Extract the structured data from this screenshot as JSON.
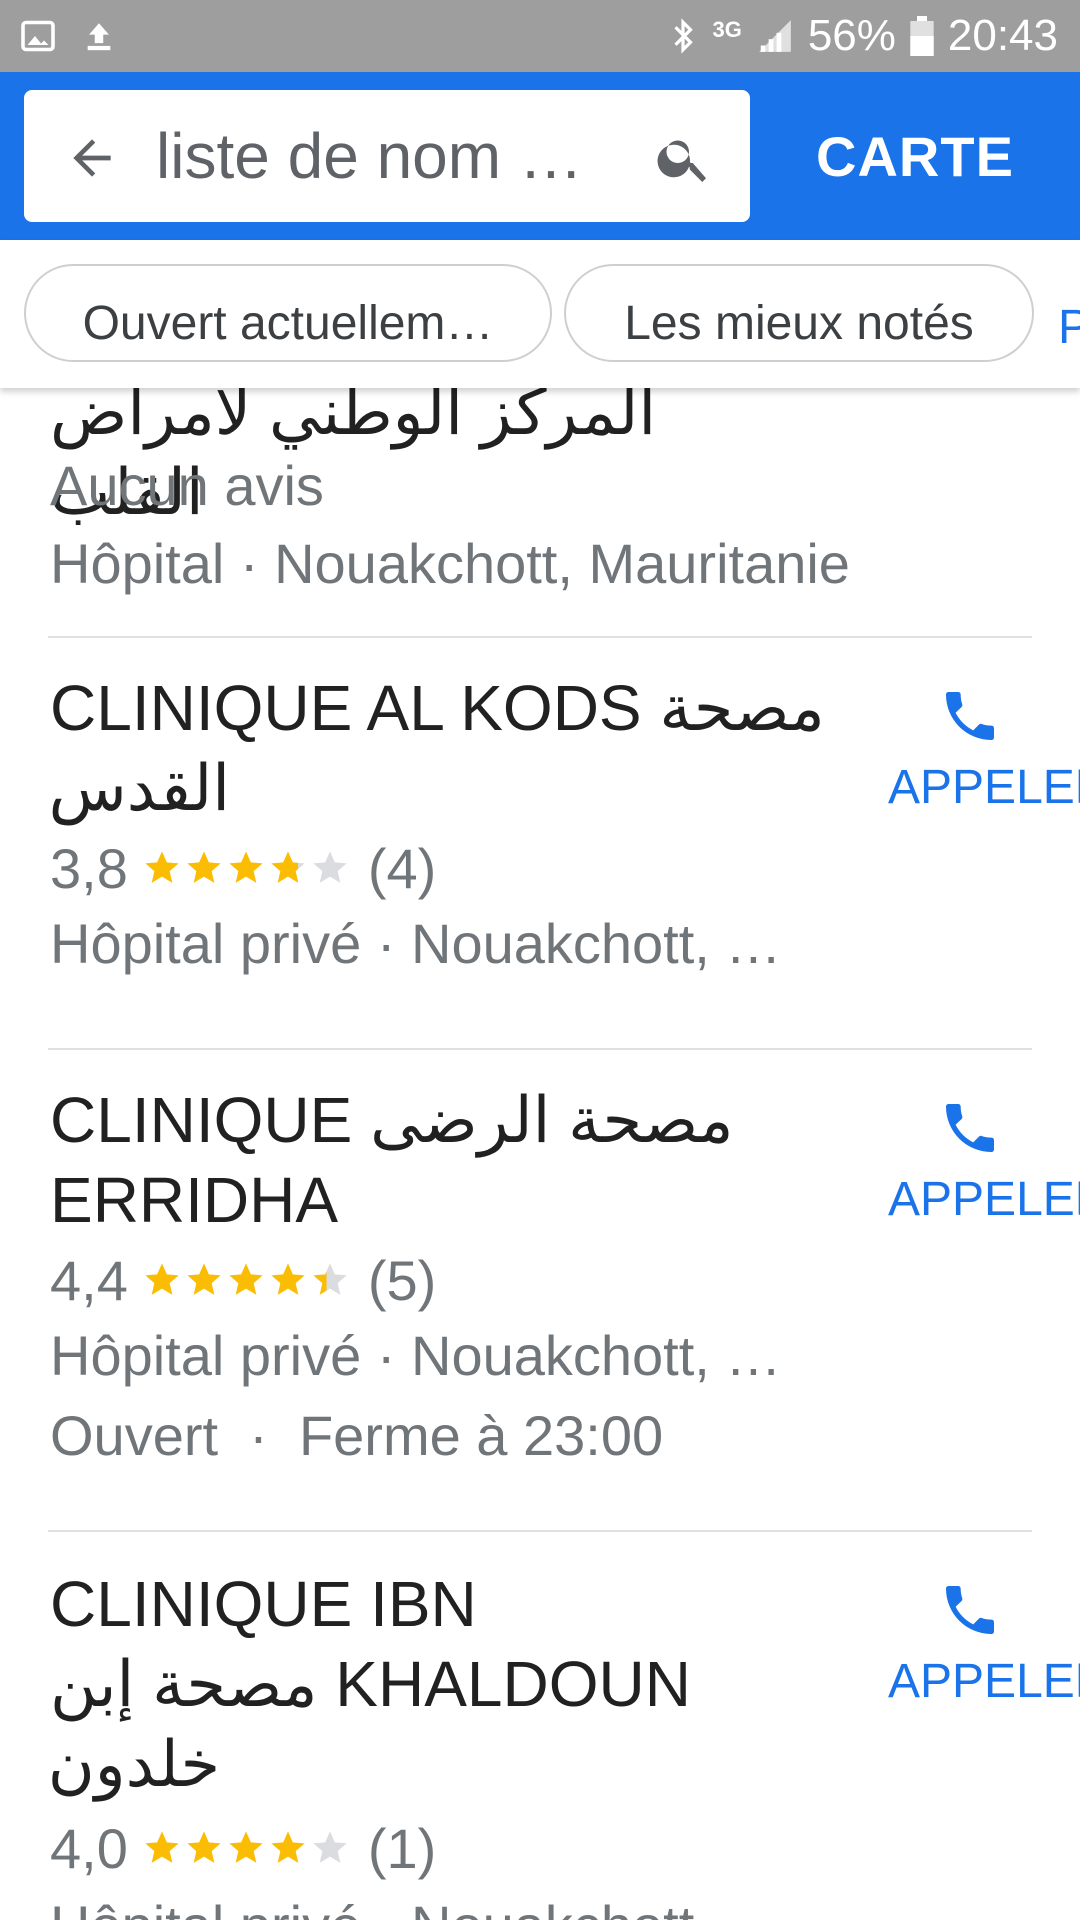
{
  "status_bar": {
    "battery": "56%",
    "time": "20:43",
    "network": "3G",
    "left_icons": [
      "image-icon",
      "upload-icon"
    ],
    "right_icons": [
      "bluetooth-icon",
      "signal-icon",
      "battery-icon"
    ]
  },
  "search": {
    "query": "liste de nom …",
    "map_button": "CARTE"
  },
  "chips": [
    "Ouvert actuellem…",
    "Les mieux notés",
    "P"
  ],
  "results": [
    {
      "name": "المركز الوطني لأمراض القلب",
      "rating_text": "Aucun avis",
      "category": "Hôpital · Nouakchott, Mauritanie"
    },
    {
      "name_line1": "CLINIQUE AL KODS مصحة",
      "name_line2": "القدس",
      "rating": "3,8",
      "rating_value": 3.8,
      "reviews": "(4)",
      "category": "Hôpital privé · Nouakchott, …",
      "call_label": "APPELER"
    },
    {
      "name_line1": "CLINIQUE مصحة الرضى",
      "name_line2": "ERRIDHA",
      "rating": "4,4",
      "rating_value": 4.4,
      "reviews": "(5)",
      "category": "Hôpital privé · Nouakchott, …",
      "hours": "Ouvert  ·  Ferme à 23:00",
      "call_label": "APPELER"
    },
    {
      "name_line1": "CLINIQUE IBN",
      "name_line2": "مصحة إبن KHALDOUN",
      "name_line3": "خلدون",
      "rating": "4,0",
      "rating_value": 4.0,
      "reviews": "(1)",
      "category": "Hôpital privé · Nouakchott, …",
      "call_label": "APPELER"
    }
  ],
  "colors": {
    "primary": "#1a73e8",
    "star": "#fbbc04",
    "star_empty": "#dadce0",
    "status_bar": "#9e9e9e"
  }
}
